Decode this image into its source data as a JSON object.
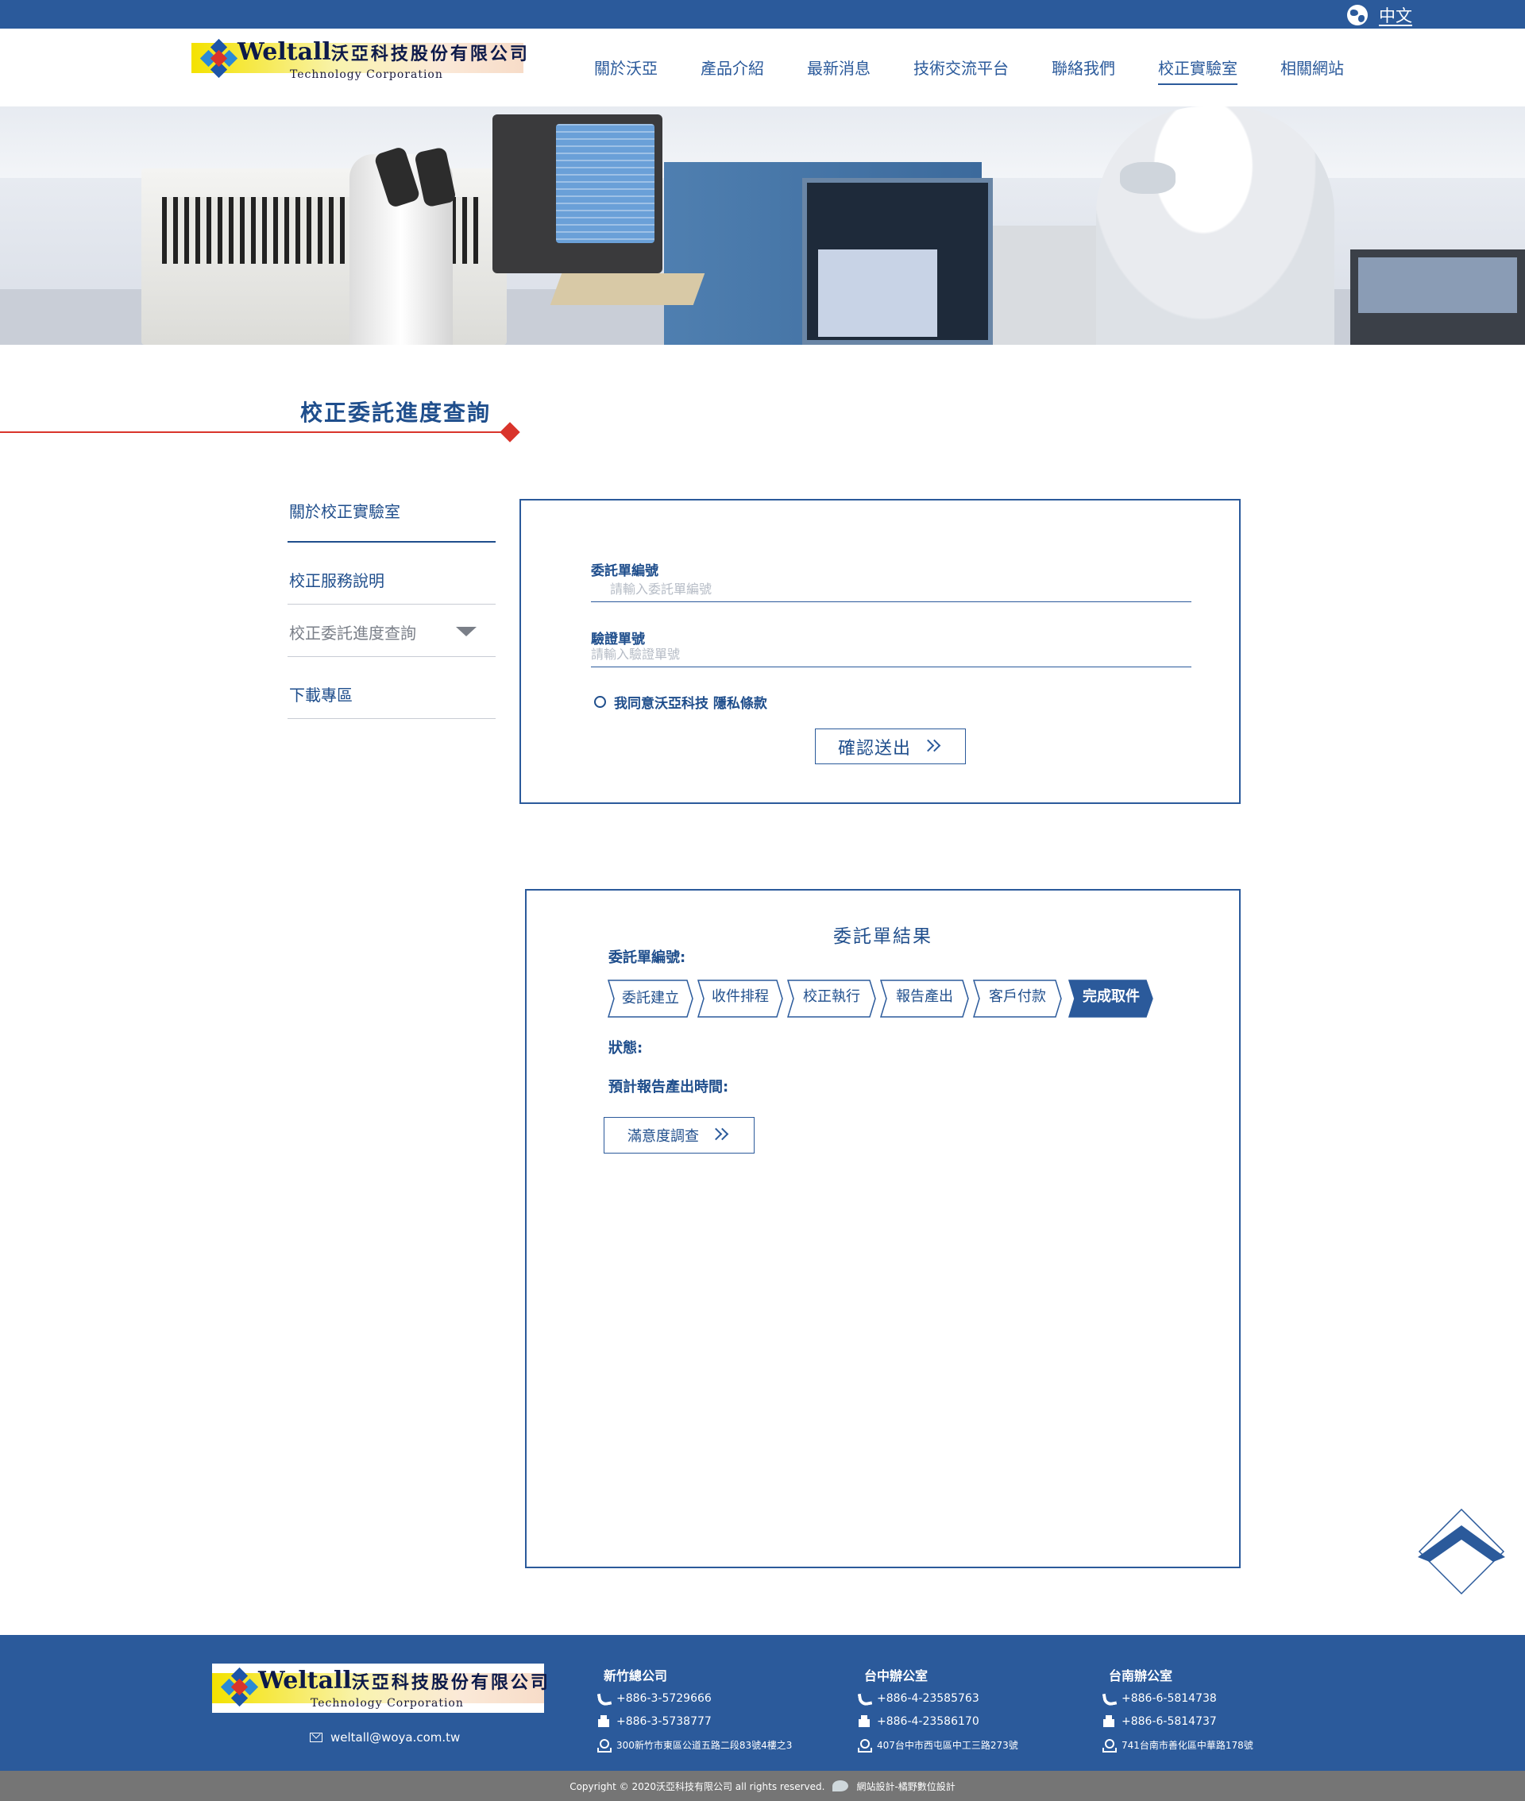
{
  "topbar": {
    "language": "中文"
  },
  "logo": {
    "brand_en": "Weltall",
    "brand_cn": "沃亞科技股份有限公司",
    "tagline": "Technology Corporation"
  },
  "nav": {
    "items": [
      "關於沃亞",
      "產品介紹",
      "最新消息",
      "技術交流平台",
      "聯絡我們",
      "校正實驗室",
      "相關網站"
    ],
    "active": "校正實驗室"
  },
  "page": {
    "title": "校正委託進度查詢"
  },
  "side_menu": {
    "items": [
      "關於校正實驗室",
      "校正服務說明",
      "校正委託進度查詢",
      "下載專區"
    ],
    "selected": "校正委託進度查詢"
  },
  "form": {
    "order_label": "委託單編號",
    "order_placeholder": "請輸入委託單編號",
    "verify_label": "驗證單號",
    "verify_placeholder": "請輸入驗證單號",
    "agree_text": "我同意沃亞科技 隱私條款",
    "submit_label": "確認送出"
  },
  "result": {
    "title": "委託單結果",
    "order_label": "委託單編號:",
    "steps": [
      "委託建立",
      "收件排程",
      "校正執行",
      "報告產出",
      "客戶付款",
      "完成取件"
    ],
    "current_step": "完成取件",
    "status_label": "狀態:",
    "eta_label": "預計報告產出時間:",
    "survey_label": "滿意度調查"
  },
  "footer": {
    "email": "weltall@woya.com.tw",
    "offices": [
      {
        "name": "新竹總公司",
        "phone": "+886-3-5729666",
        "fax": "+886-3-5738777",
        "address": "300新竹市東區公道五路二段83號4樓之3"
      },
      {
        "name": "台中辦公室",
        "phone": "+886-4-23585763",
        "fax": "+886-4-23586170",
        "address": "407台中市西屯區中工三路273號"
      },
      {
        "name": "台南辦公室",
        "phone": "+886-6-5814738",
        "fax": "+886-6-5814737",
        "address": "741台南市善化區中華路178號"
      }
    ],
    "copyright": "Copyright © 2020沃亞科技有限公司 all rights reserved.",
    "designer": "網站設計-橘野數位設計"
  },
  "colors": {
    "primary": "#2b5a9b",
    "accent": "#d9342b",
    "footer_bottom": "#757575"
  },
  "icons": {
    "language": "globe-icon",
    "back_to_top": "chevron-up-icon",
    "email": "mail-icon",
    "phone": "phone-icon",
    "fax": "fax-icon",
    "address": "location-icon"
  }
}
